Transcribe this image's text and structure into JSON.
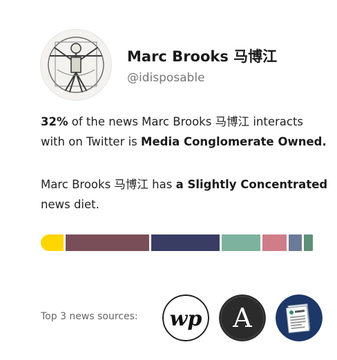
{
  "profile": {
    "name": "Marc Brooks 马博江",
    "handle": "@idisposable"
  },
  "summary": {
    "percent": "32%",
    "line1_mid": " of the news Marc Brooks 马博江 interacts with on Twitter is ",
    "ownership": "Media Conglomerate Owned.",
    "line2_start": "Marc Brooks 马博江 has ",
    "diet": "a Slightly Concentrated",
    "line2_end": " news diet."
  },
  "diet_bar": {
    "segments": [
      {
        "color": "#ffd600",
        "share": 0.085
      },
      {
        "color": "#7a4e58",
        "share": 0.315
      },
      {
        "color": "#393c63",
        "share": 0.256
      },
      {
        "color": "#7db39e",
        "share": 0.146
      },
      {
        "color": "#cf7d88",
        "share": 0.091
      },
      {
        "color": "#6b7a98",
        "share": 0.05
      },
      {
        "color": "#5f8f78",
        "share": 0.033
      }
    ]
  },
  "sources": {
    "label": "Top 3 news sources:",
    "items": [
      {
        "icon": "washington-post-logo",
        "logo_text": "wp",
        "bg": "#ffffff",
        "fg": "#111111"
      },
      {
        "icon": "the-atlantic-logo",
        "logo_text": "A",
        "bg": "#2b2b2b",
        "fg": "#ffffff"
      },
      {
        "icon": "newspaper-logo",
        "logo_text": "",
        "bg": "#1c3768",
        "fg": "#ffffff"
      }
    ]
  }
}
